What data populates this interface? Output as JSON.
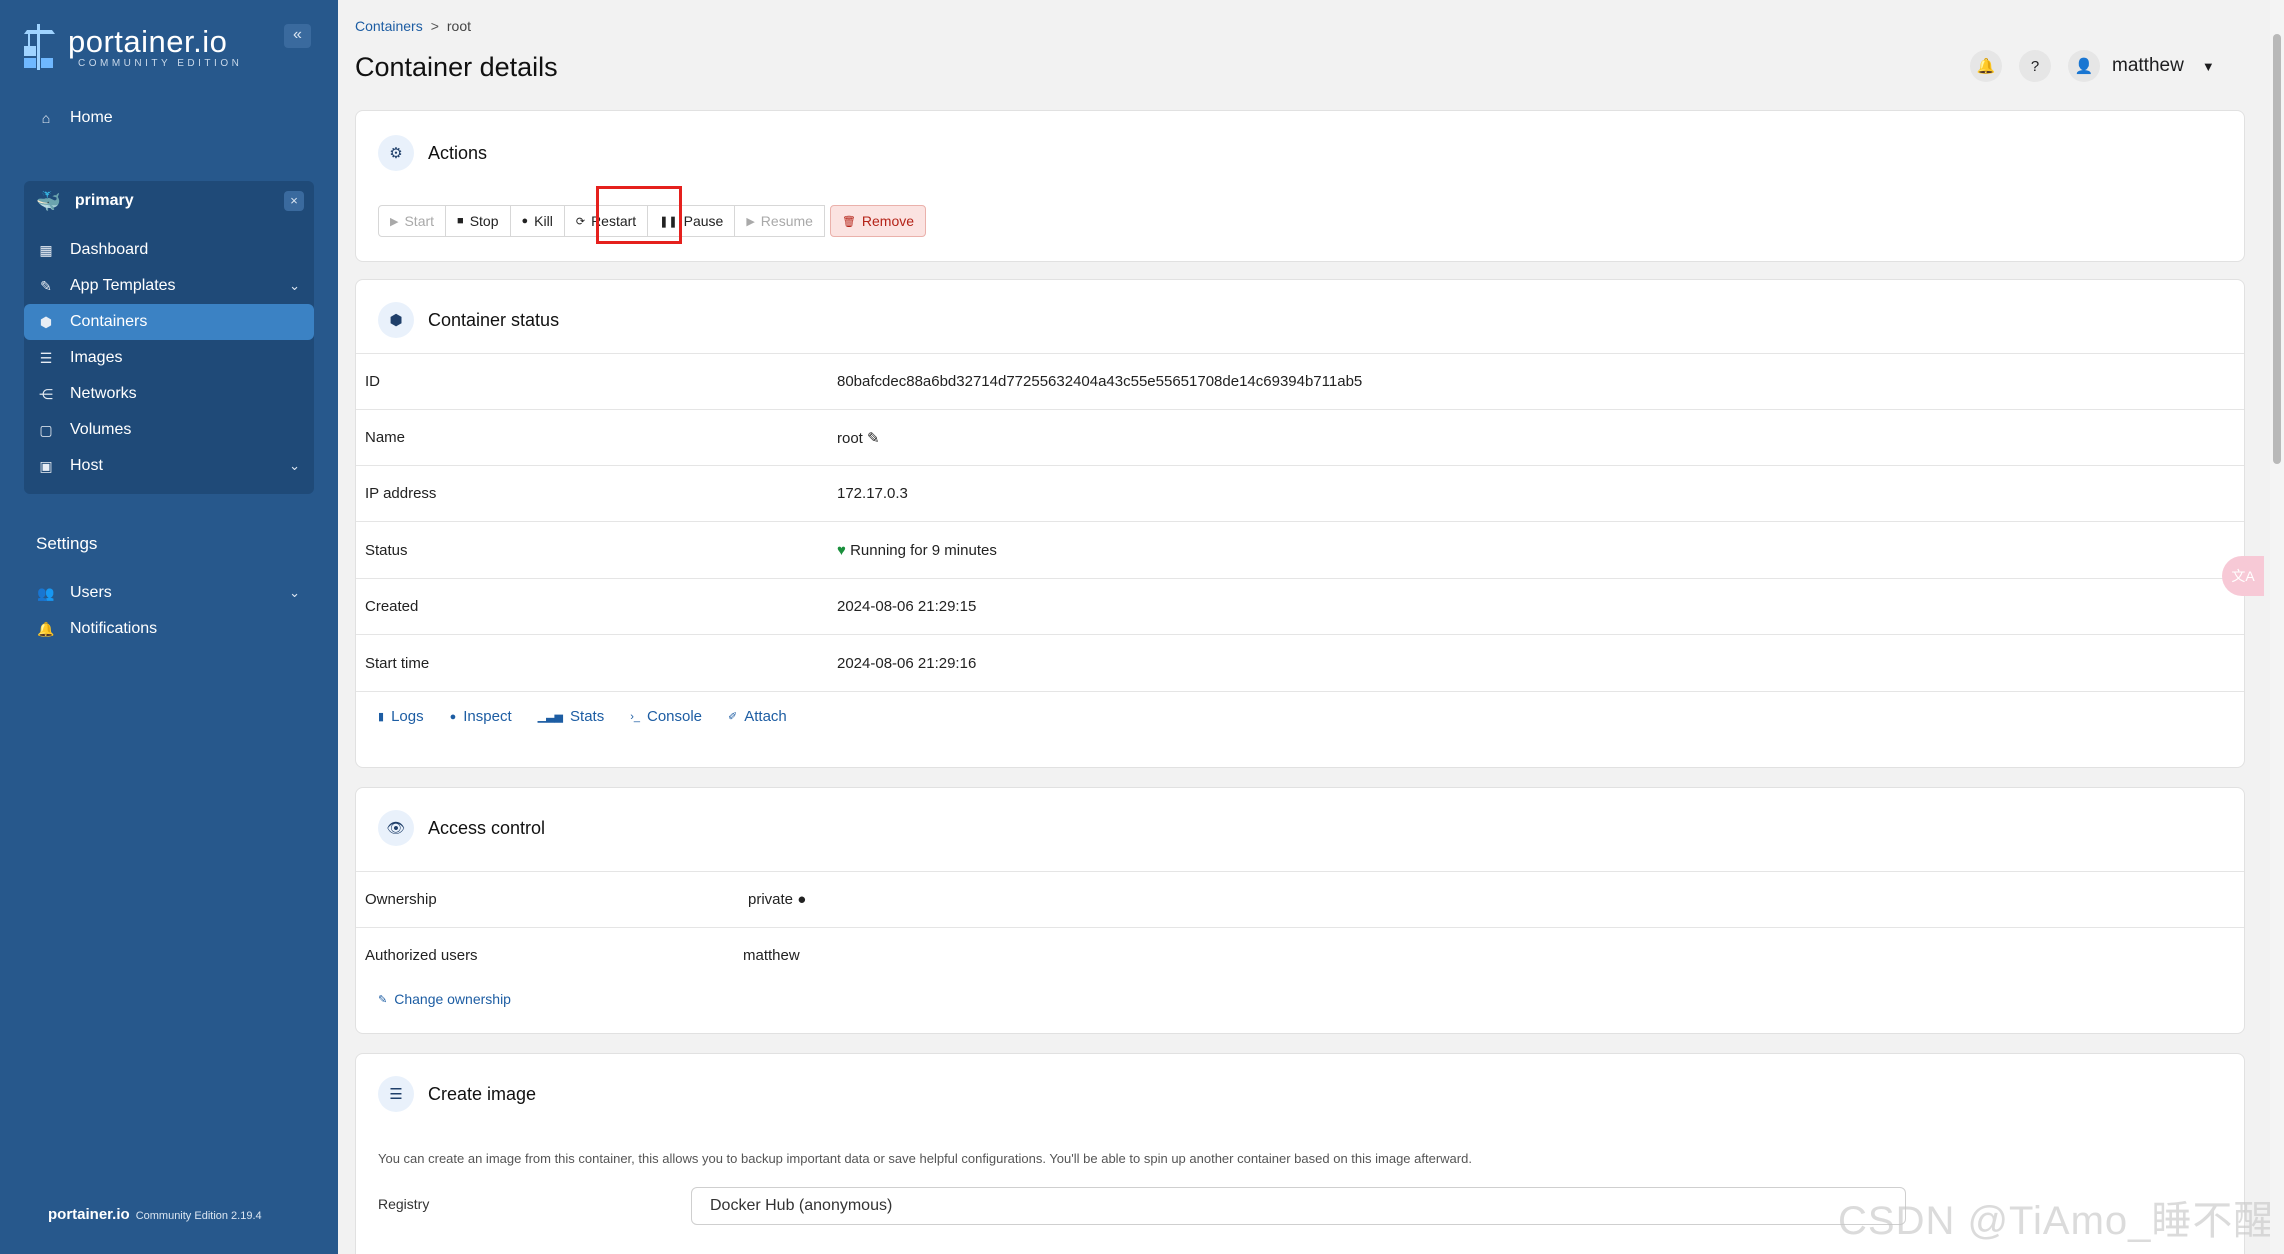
{
  "app": {
    "logo_main": "portainer.io",
    "logo_sub": "COMMUNITY EDITION",
    "collapse_icon": "«",
    "footer_brand": "portainer.io",
    "footer_edition": "Community Edition 2.19.4"
  },
  "sidebar": {
    "home": "Home",
    "environment": "primary",
    "env_close": "×",
    "items": [
      {
        "label": "Dashboard"
      },
      {
        "label": "App Templates"
      },
      {
        "label": "Containers"
      },
      {
        "label": "Images"
      },
      {
        "label": "Networks"
      },
      {
        "label": "Volumes"
      },
      {
        "label": "Host"
      }
    ],
    "settings_label": "Settings",
    "settings_items": [
      {
        "label": "Users"
      },
      {
        "label": "Notifications"
      }
    ]
  },
  "header": {
    "breadcrumb_parent": "Containers",
    "breadcrumb_sep": ">",
    "breadcrumb_current": "root",
    "title": "Container details",
    "user": "matthew"
  },
  "actions": {
    "title": "Actions",
    "buttons": [
      "Start",
      "Stop",
      "Kill",
      "Restart",
      "Pause",
      "Resume",
      "Remove"
    ]
  },
  "status": {
    "title": "Container status",
    "rows": [
      {
        "key": "ID",
        "value": "80bafcdec88a6bd32714d77255632404a43c55e55651708de14c69394b711ab5"
      },
      {
        "key": "Name",
        "value": "root"
      },
      {
        "key": "IP address",
        "value": "172.17.0.3"
      },
      {
        "key": "Status",
        "value": "Running for 9 minutes"
      },
      {
        "key": "Created",
        "value": "2024-08-06 21:29:15"
      },
      {
        "key": "Start time",
        "value": "2024-08-06 21:29:16"
      }
    ],
    "links": [
      "Logs",
      "Inspect",
      "Stats",
      "Console",
      "Attach"
    ]
  },
  "access": {
    "title": "Access control",
    "ownership_label": "Ownership",
    "ownership_value": "private",
    "users_label": "Authorized users",
    "users_value": "matthew",
    "change_link": "Change ownership"
  },
  "create_image": {
    "title": "Create image",
    "description": "You can create an image from this container, this allows you to backup important data or save helpful configurations. You'll be able to spin up another container based on this image afterward.",
    "registry_label": "Registry",
    "registry_value": "Docker Hub (anonymous)"
  },
  "overlay": {
    "watermark": "CSDN @TiAmo_睡不醒"
  }
}
